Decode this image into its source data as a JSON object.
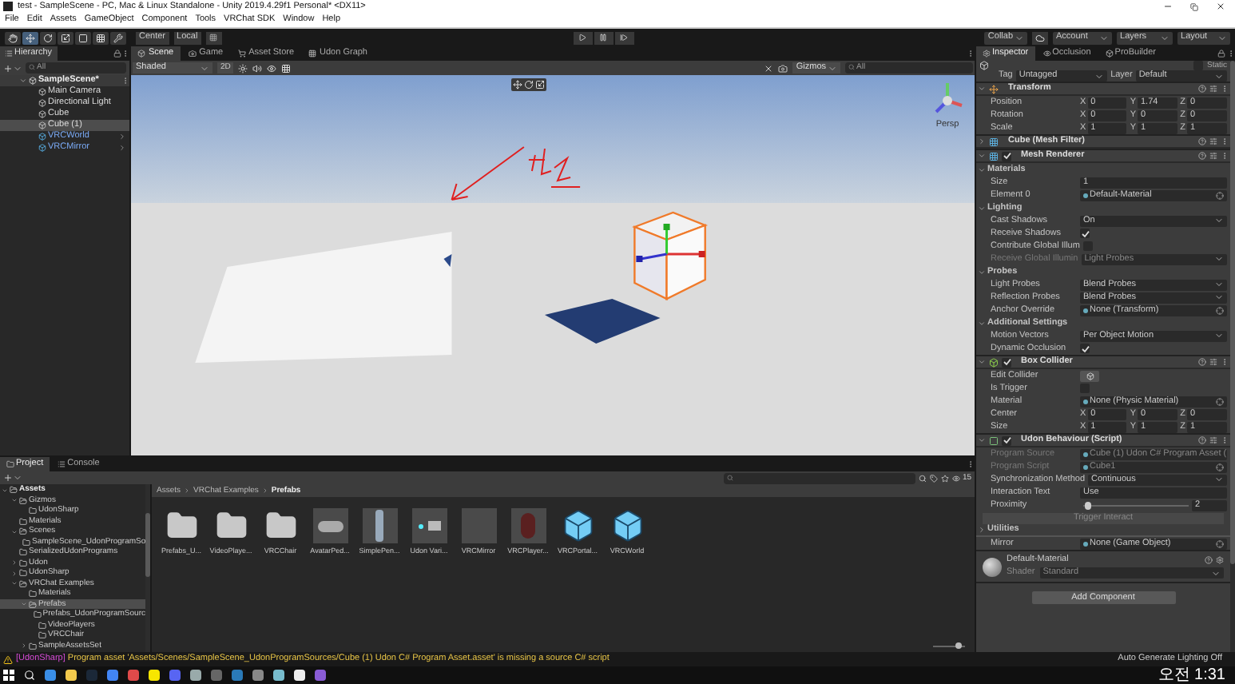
{
  "window": {
    "title": "test - SampleScene - PC, Mac & Linux Standalone - Unity 2019.4.29f1 Personal* <DX11>"
  },
  "menu": [
    "File",
    "Edit",
    "Assets",
    "GameObject",
    "Component",
    "Tools",
    "VRChat SDK",
    "Window",
    "Help"
  ],
  "toolbar": {
    "pivot": "Center",
    "space": "Local",
    "collab": "Collab",
    "account": "Account",
    "layers": "Layers",
    "layout": "Layout"
  },
  "hierarchy": {
    "title": "Hierarchy",
    "search_placeholder": "All",
    "scene": {
      "label": "SampleScene*",
      "expanded": true
    },
    "objects": [
      {
        "label": "Main Camera",
        "kind": "object",
        "selected": false
      },
      {
        "label": "Directional Light",
        "kind": "object",
        "selected": false
      },
      {
        "label": "Cube",
        "kind": "object",
        "selected": false
      },
      {
        "label": "Cube (1)",
        "kind": "object",
        "selected": true
      },
      {
        "label": "VRCWorld",
        "kind": "prefab",
        "selected": false
      },
      {
        "label": "VRCMirror",
        "kind": "prefab",
        "selected": false
      }
    ]
  },
  "scene_view": {
    "tabs": [
      {
        "label": "Scene",
        "selected": true
      },
      {
        "label": "Game",
        "selected": false
      },
      {
        "label": "Asset Store",
        "selected": false
      },
      {
        "label": "Udon Graph",
        "selected": false
      }
    ],
    "shading": "Shaded",
    "mode_2d": "2D",
    "gizmos": "Gizmos",
    "search_placeholder": "All",
    "projection": "Persp"
  },
  "inspector": {
    "tabs": [
      {
        "label": "Inspector",
        "selected": true
      },
      {
        "label": "Occlusion",
        "selected": false
      },
      {
        "label": "ProBuilder",
        "selected": false
      }
    ],
    "static_label": "Static",
    "static": false,
    "tag_label": "Tag",
    "tag": "Untagged",
    "layer_label": "Layer",
    "layer": "Default",
    "components": [
      {
        "title": "Transform",
        "kind": "transform",
        "expanded": true,
        "rows": [
          {
            "kind": "xyz",
            "label": "Position",
            "disabled": false,
            "values": [
              {
                "axis": "X",
                "value": "0"
              },
              {
                "axis": "Y",
                "value": "1.74"
              },
              {
                "axis": "Z",
                "value": "0"
              }
            ]
          },
          {
            "kind": "xyz",
            "label": "Rotation",
            "disabled": false,
            "values": [
              {
                "axis": "X",
                "value": "0"
              },
              {
                "axis": "Y",
                "value": "0"
              },
              {
                "axis": "Z",
                "value": "0"
              }
            ]
          },
          {
            "kind": "xyz",
            "label": "Scale",
            "disabled": false,
            "values": [
              {
                "axis": "X",
                "value": "1"
              },
              {
                "axis": "Y",
                "value": "1"
              },
              {
                "axis": "Z",
                "value": "1"
              }
            ]
          }
        ]
      },
      {
        "title": "Cube (Mesh Filter)",
        "kind": "mesh",
        "expanded": false
      },
      {
        "title": "Mesh Renderer",
        "kind": "mesh",
        "enabled": true,
        "expanded": true,
        "rows": [
          {
            "kind": "header",
            "label": "Materials",
            "disabled": false
          },
          {
            "kind": "text",
            "label": "Size",
            "value": "1",
            "disabled": false
          },
          {
            "kind": "object",
            "label": "Element 0",
            "value": "Default-Material",
            "disabled": false
          },
          {
            "kind": "header",
            "label": "Lighting",
            "disabled": false
          },
          {
            "kind": "dropdown",
            "label": "Cast Shadows",
            "value": "On",
            "disabled": false
          },
          {
            "kind": "checkbox",
            "label": "Receive Shadows",
            "checked": true,
            "disabled": false
          },
          {
            "kind": "checkbox",
            "label": "Contribute Global Illum",
            "checked": false,
            "disabled": false
          },
          {
            "kind": "dropdown",
            "label": "Receive Global Illumin",
            "value": "Light Probes",
            "disabled": true
          },
          {
            "kind": "header",
            "label": "Probes",
            "disabled": false
          },
          {
            "kind": "dropdown",
            "label": "Light Probes",
            "value": "Blend Probes",
            "disabled": false
          },
          {
            "kind": "dropdown",
            "label": "Reflection Probes",
            "value": "Blend Probes",
            "disabled": false
          },
          {
            "kind": "object",
            "label": "Anchor Override",
            "value": "None (Transform)",
            "disabled": false
          },
          {
            "kind": "header",
            "label": "Additional Settings",
            "disabled": false
          },
          {
            "kind": "dropdown",
            "label": "Motion Vectors",
            "value": "Per Object Motion",
            "disabled": false
          },
          {
            "kind": "checkbox",
            "label": "Dynamic Occlusion",
            "checked": true,
            "disabled": false
          }
        ]
      },
      {
        "title": "Box Collider",
        "kind": "collider",
        "enabled": true,
        "expanded": true,
        "rows": [
          {
            "kind": "edit",
            "label": "Edit Collider",
            "disabled": false
          },
          {
            "kind": "checkbox",
            "label": "Is Trigger",
            "checked": false,
            "disabled": false
          },
          {
            "kind": "object",
            "label": "Material",
            "value": "None (Physic Material)",
            "disabled": false
          },
          {
            "kind": "xyz",
            "label": "Center",
            "disabled": false,
            "values": [
              {
                "axis": "X",
                "value": "0"
              },
              {
                "axis": "Y",
                "value": "0"
              },
              {
                "axis": "Z",
                "value": "0"
              }
            ]
          },
          {
            "kind": "xyz",
            "label": "Size",
            "disabled": false,
            "values": [
              {
                "axis": "X",
                "value": "1"
              },
              {
                "axis": "Y",
                "value": "1"
              },
              {
                "axis": "Z",
                "value": "1"
              }
            ]
          }
        ]
      },
      {
        "title": "Udon Behaviour (Script)",
        "kind": "script",
        "enabled": true,
        "expanded": true,
        "rows": [
          {
            "kind": "object",
            "label": "Program Source",
            "value": "Cube (1) Udon C# Program Asset (",
            "disabled": true
          },
          {
            "kind": "object",
            "label": "Program Script",
            "value": "Cube1",
            "disabled": true
          },
          {
            "kind": "dropdown",
            "label": "Synchronization Method",
            "value": "Continuous",
            "disabled": false
          },
          {
            "kind": "text",
            "label": "Interaction Text",
            "value": "Use",
            "disabled": false
          },
          {
            "kind": "slider",
            "label": "Proximity",
            "level": 0.05,
            "reading": "2",
            "disabled": false
          },
          {
            "kind": "button",
            "label": "Trigger Interact",
            "disabled": true
          },
          {
            "kind": "collapsed",
            "label": "Utilities",
            "disabled": false
          },
          {
            "kind": "object",
            "label": "Mirror",
            "value": "None (Game Object)",
            "disabled": false
          }
        ]
      }
    ],
    "material": {
      "name": "Default-Material",
      "shader_label": "Shader",
      "shader": "Standard"
    },
    "add_component": "Add Component"
  },
  "project": {
    "tabs": [
      {
        "label": "Project",
        "selected": true
      },
      {
        "label": "Console",
        "selected": false
      }
    ],
    "count": "15",
    "icon_size": {
      "level": 0.8
    },
    "tree": [
      {
        "label": "Assets",
        "expanded": true,
        "selected": false,
        "children": [
          {
            "label": "Gizmos",
            "expanded": true,
            "selected": false,
            "children": [
              {
                "label": "UdonSharp",
                "selected": false
              }
            ]
          },
          {
            "label": "Materials",
            "selected": false
          },
          {
            "label": "Scenes",
            "expanded": true,
            "selected": false,
            "children": [
              {
                "label": "SampleScene_UdonProgramSo",
                "selected": false
              }
            ]
          },
          {
            "label": "SerializedUdonPrograms",
            "selected": false
          },
          {
            "label": "Udon",
            "expanded": false,
            "selected": false
          },
          {
            "label": "UdonSharp",
            "expanded": false,
            "selected": false
          },
          {
            "label": "VRChat Examples",
            "expanded": true,
            "selected": false,
            "children": [
              {
                "label": "Materials",
                "selected": false
              },
              {
                "label": "Prefabs",
                "expanded": true,
                "selected": true,
                "children": [
                  {
                    "label": "Prefabs_UdonProgramSourc",
                    "selected": false
                  },
                  {
                    "label": "VideoPlayers",
                    "selected": false
                  },
                  {
                    "label": "VRCChair",
                    "selected": false
                  }
                ]
              },
              {
                "label": "SampleAssetsSet",
                "expanded": false,
                "selected": false
              }
            ]
          }
        ]
      }
    ],
    "breadcrumb": [
      "Assets",
      "VRChat Examples",
      "Prefabs"
    ],
    "assets": [
      {
        "label": "Prefabs_U...",
        "kind": "folder"
      },
      {
        "label": "VideoPlaye...",
        "kind": "folder"
      },
      {
        "label": "VRCChair",
        "kind": "folder"
      },
      {
        "label": "AvatarPed...",
        "kind": "pedestal"
      },
      {
        "label": "SimplePen...",
        "kind": "pen"
      },
      {
        "label": "Udon Vari...",
        "kind": "camera"
      },
      {
        "label": "VRCMirror",
        "kind": "blank"
      },
      {
        "label": "VRCPlayer...",
        "kind": "disc"
      },
      {
        "label": "VRCPortal...",
        "kind": "prefab"
      },
      {
        "label": "VRCWorld",
        "kind": "prefab"
      }
    ]
  },
  "status_bar": {
    "tag": "[UdonSharp]",
    "message": "Program asset 'Assets/Scenes/SampleScene_UdonProgramSources/Cube (1) Udon C# Program Asset.asset' is missing a source C# script",
    "lighting": "Auto Generate Lighting Off"
  },
  "taskbar": {
    "time": "오전 1:31"
  }
}
